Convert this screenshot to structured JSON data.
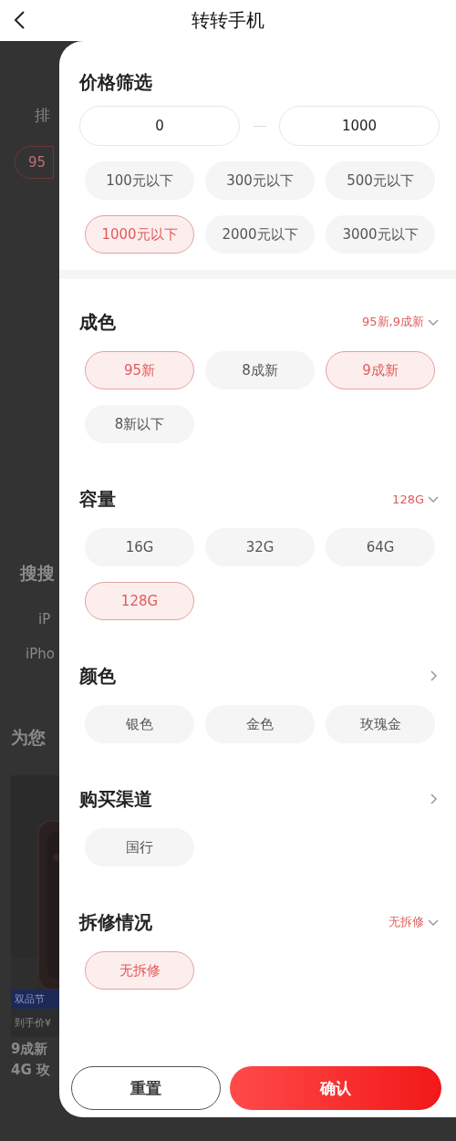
{
  "header": {
    "title": "转转手机"
  },
  "background": {
    "sort_label": "排",
    "chip": "95",
    "search_title": "搜搜",
    "search_items": [
      "iP",
      "iPho"
    ],
    "recommend_title": "为您",
    "card": {
      "tag": "双品节",
      "price": "到手价¥",
      "name_lines": [
        "9成新",
        "4G 玫"
      ]
    }
  },
  "price": {
    "title": "价格筛选",
    "min": "0",
    "max": "1000",
    "options": [
      {
        "label": "100元以下",
        "selected": false
      },
      {
        "label": "300元以下",
        "selected": false
      },
      {
        "label": "500元以下",
        "selected": false
      },
      {
        "label": "1000元以下",
        "selected": true
      },
      {
        "label": "2000元以下",
        "selected": false
      },
      {
        "label": "3000元以下",
        "selected": false
      }
    ]
  },
  "sections": [
    {
      "title": "成色",
      "summary": "95新,9成新",
      "options": [
        {
          "label": "95新",
          "selected": true
        },
        {
          "label": "8成新",
          "selected": false
        },
        {
          "label": "9成新",
          "selected": true
        },
        {
          "label": "8新以下",
          "selected": false
        }
      ]
    },
    {
      "title": "容量",
      "summary": "128G",
      "options": [
        {
          "label": "16G",
          "selected": false
        },
        {
          "label": "32G",
          "selected": false
        },
        {
          "label": "64G",
          "selected": false
        },
        {
          "label": "128G",
          "selected": true
        }
      ]
    },
    {
      "title": "颜色",
      "options": [
        {
          "label": "银色",
          "selected": false
        },
        {
          "label": "金色",
          "selected": false
        },
        {
          "label": "玫瑰金",
          "selected": false
        }
      ]
    },
    {
      "title": "购买渠道",
      "options": [
        {
          "label": "国行",
          "selected": false
        }
      ]
    },
    {
      "title": "拆修情况",
      "summary": "无拆修",
      "options": [
        {
          "label": "无拆修",
          "selected": true
        }
      ]
    }
  ],
  "buttons": [
    {
      "label": "重置",
      "kind": "outline"
    },
    {
      "label": "确认",
      "kind": "primary"
    }
  ]
}
